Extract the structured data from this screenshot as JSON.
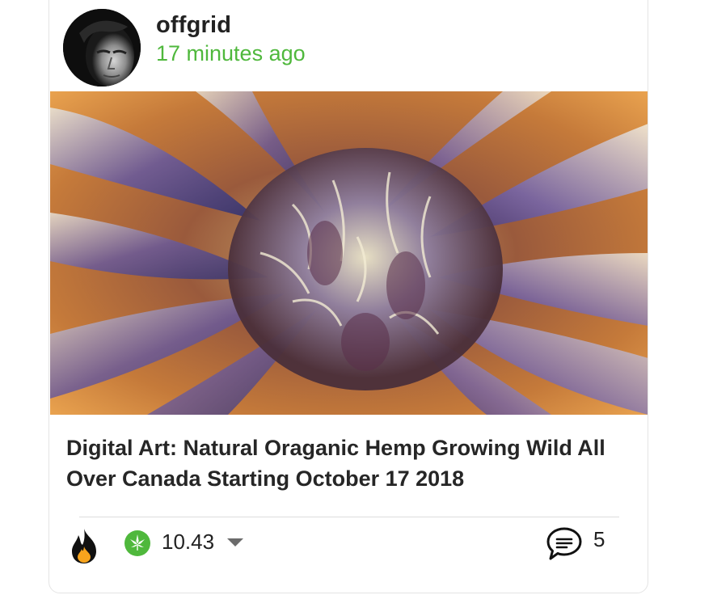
{
  "post": {
    "author": "offgrid",
    "time_ago": "17 minutes ago",
    "title": "Digital Art: Natural Oraganic Hemp Growing Wild All Over Canada Starting October 17 2018",
    "payout": "10.43",
    "comment_count": "5"
  },
  "icons": {
    "vote": "fire-icon",
    "payout": "hemp-leaf-icon",
    "payout_menu": "chevron-down-icon",
    "comments": "comment-bubble-icon"
  },
  "colors": {
    "accent_green": "#4fb83c",
    "title_text": "#262626",
    "fire_orange": "#f7a41d"
  }
}
